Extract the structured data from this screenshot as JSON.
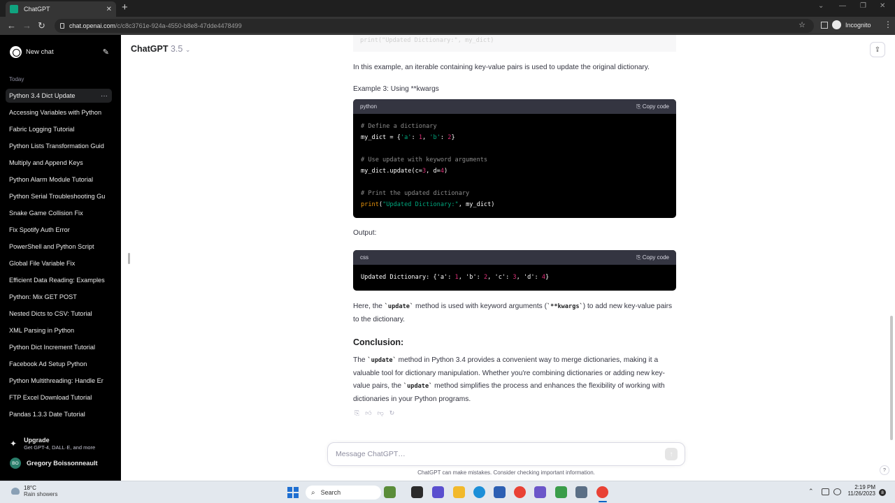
{
  "browser": {
    "tab_title": "ChatGPT",
    "url_host": "chat.openai.com",
    "url_path": "/c/c8c3761e-924a-4550-b8e8-47dde4478499",
    "incognito_label": "Incognito"
  },
  "sidebar": {
    "new_chat_label": "New chat",
    "section_label": "Today",
    "items": [
      {
        "label": "Python 3.4 Dict Update",
        "active": true
      },
      {
        "label": "Accessing Variables with Python"
      },
      {
        "label": "Fabric Logging Tutorial"
      },
      {
        "label": "Python Lists Transformation Guid"
      },
      {
        "label": "Multiply and Append Keys"
      },
      {
        "label": "Python Alarm Module Tutorial"
      },
      {
        "label": "Python Serial Troubleshooting Gu"
      },
      {
        "label": "Snake Game Collision Fix"
      },
      {
        "label": "Fix Spotify Auth Error"
      },
      {
        "label": "PowerShell and Python Script"
      },
      {
        "label": "Global File Variable Fix"
      },
      {
        "label": "Efficient Data Reading: Examples"
      },
      {
        "label": "Python: Mix GET POST"
      },
      {
        "label": "Nested Dicts to CSV: Tutorial"
      },
      {
        "label": "XML Parsing in Python"
      },
      {
        "label": "Python Dict Increment Tutorial"
      },
      {
        "label": "Facebook Ad Setup Python"
      },
      {
        "label": "Python Multithreading: Handle Er"
      },
      {
        "label": "FTP Excel Download Tutorial"
      },
      {
        "label": "Pandas 1.3.3 Date Tutorial"
      }
    ],
    "upgrade_title": "Upgrade",
    "upgrade_sub": "Get GPT-4, DALL·E, and more",
    "user_initials": "BO",
    "user_name": "Gregory Boissonneault"
  },
  "header": {
    "model_name": "ChatGPT",
    "model_version": "3.5"
  },
  "content": {
    "faded_code": "print(\"Updated Dictionary:\", my_dict)",
    "para1": "In this example, an iterable containing key-value pairs is used to update the original dictionary.",
    "example3_title": "Example 3: Using **kwargs",
    "code1_lang": "python",
    "copy_label": "Copy code",
    "code1_lines": [
      {
        "segments": [
          {
            "t": "# Define a dictionary",
            "c": "com"
          }
        ]
      },
      {
        "segments": [
          {
            "t": "my_dict = {",
            "c": "plain"
          },
          {
            "t": "'a'",
            "c": "str"
          },
          {
            "t": ": ",
            "c": "plain"
          },
          {
            "t": "1",
            "c": "num"
          },
          {
            "t": ", ",
            "c": "plain"
          },
          {
            "t": "'b'",
            "c": "str"
          },
          {
            "t": ": ",
            "c": "plain"
          },
          {
            "t": "2",
            "c": "num"
          },
          {
            "t": "}",
            "c": "plain"
          }
        ]
      },
      {
        "segments": [
          {
            "t": "",
            "c": "plain"
          }
        ]
      },
      {
        "segments": [
          {
            "t": "# Use update with keyword arguments",
            "c": "com"
          }
        ]
      },
      {
        "segments": [
          {
            "t": "my_dict.update(c=",
            "c": "plain"
          },
          {
            "t": "3",
            "c": "num"
          },
          {
            "t": ", d=",
            "c": "plain"
          },
          {
            "t": "4",
            "c": "num"
          },
          {
            "t": ")",
            "c": "plain"
          }
        ]
      },
      {
        "segments": [
          {
            "t": "",
            "c": "plain"
          }
        ]
      },
      {
        "segments": [
          {
            "t": "# Print the updated dictionary",
            "c": "com"
          }
        ]
      },
      {
        "segments": [
          {
            "t": "print",
            "c": "fn"
          },
          {
            "t": "(",
            "c": "plain"
          },
          {
            "t": "\"Updated Dictionary:\"",
            "c": "str"
          },
          {
            "t": ", my_dict)",
            "c": "plain"
          }
        ]
      }
    ],
    "output_label": "Output:",
    "code2_lang": "css",
    "code2_lines": [
      {
        "segments": [
          {
            "t": "Updated Dictionary: {",
            "c": "plain"
          },
          {
            "t": "'a'",
            "c": "plain"
          },
          {
            "t": ": ",
            "c": "plain"
          },
          {
            "t": "1",
            "c": "num"
          },
          {
            "t": ", ",
            "c": "plain"
          },
          {
            "t": "'b'",
            "c": "plain"
          },
          {
            "t": ": ",
            "c": "plain"
          },
          {
            "t": "2",
            "c": "num"
          },
          {
            "t": ", ",
            "c": "plain"
          },
          {
            "t": "'c'",
            "c": "plain"
          },
          {
            "t": ": ",
            "c": "plain"
          },
          {
            "t": "3",
            "c": "num"
          },
          {
            "t": ", ",
            "c": "plain"
          },
          {
            "t": "'d'",
            "c": "plain"
          },
          {
            "t": ": ",
            "c": "plain"
          },
          {
            "t": "4",
            "c": "num"
          },
          {
            "t": "}",
            "c": "plain"
          }
        ]
      }
    ],
    "para2": {
      "a": "Here, the ",
      "code1": "`update`",
      "b": " method is used with keyword arguments (",
      "code2": "`**kwargs`",
      "c": ") to add new key-value pairs to the dictionary."
    },
    "conclusion_heading": "Conclusion:",
    "para3": {
      "a": "The ",
      "code1": "`update`",
      "b": " method in Python 3.4 provides a convenient way to merge dictionaries, making it a valuable tool for dictionary manipulation. Whether you're combining dictionaries or adding new key-value pairs, the ",
      "code2": "`update`",
      "c": " method simplifies the process and enhances the flexibility of working with dictionaries in your Python programs."
    }
  },
  "composer": {
    "placeholder": "Message ChatGPT…",
    "disclaimer": "ChatGPT can make mistakes. Consider checking important information."
  },
  "taskbar": {
    "temperature": "18°C",
    "weather": "Rain showers",
    "search_label": "Search",
    "time": "2:19 PM",
    "date": "11/26/2023",
    "notification_count": "8"
  },
  "colors": {
    "sidebar_bg": "#000000",
    "code_bg": "#000000",
    "code_comment": "#8c8c8c",
    "code_number": "#df3079",
    "code_string": "#00a67d",
    "code_function": "#e9950c"
  }
}
